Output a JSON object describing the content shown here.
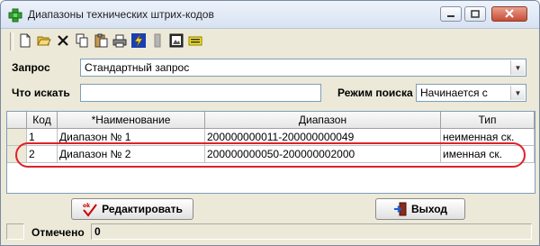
{
  "window": {
    "title": "Диапазоны технических штрих-кодов"
  },
  "toolbar": {
    "icons": [
      "new-document-icon",
      "open-folder-icon",
      "delete-icon",
      "copy-icon",
      "paste-icon",
      "print-icon",
      "lightning-icon",
      "grey-block-icon",
      "image-icon",
      "yellow-note-icon"
    ]
  },
  "form": {
    "query_label": "Запрос",
    "query_value": "Стандартный запрос",
    "search_label": "Что искать",
    "search_value": "",
    "mode_label": "Режим поиска",
    "mode_value": "Начинается с"
  },
  "grid": {
    "columns": [
      "Код",
      "*Наименование",
      "Диапазон",
      "Тип"
    ],
    "rows": [
      {
        "code": "1",
        "name": "Диапазон № 1",
        "range": "200000000011-200000000049",
        "type": "неименная ск."
      },
      {
        "code": "2",
        "name": "Диапазон № 2",
        "range": "200000000050-200000002000",
        "type": "именная ск."
      }
    ]
  },
  "buttons": {
    "edit_label": "Редактировать",
    "exit_label": "Выход"
  },
  "status": {
    "marked_label": "Отмечено",
    "marked_value": "0"
  },
  "colors": {
    "highlight": "#e0202a",
    "window_bg": "#ece9d8"
  }
}
